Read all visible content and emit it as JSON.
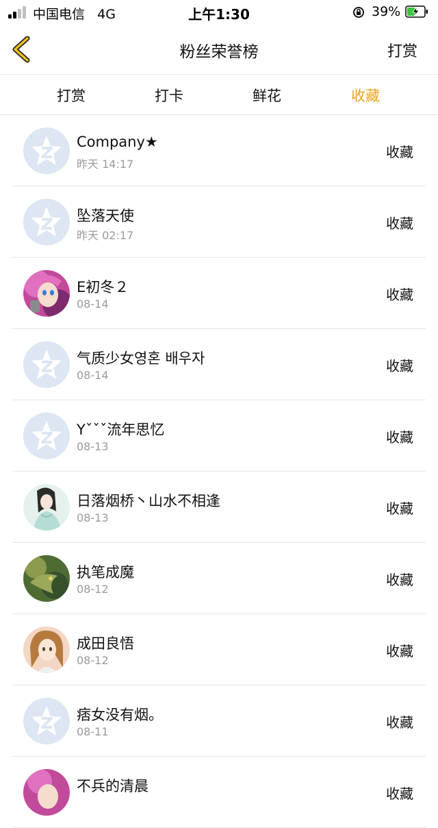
{
  "status_bar": {
    "carrier": "中国电信   4G",
    "time": "上午1:30",
    "battery": "39%"
  },
  "header": {
    "title": "粉丝荣誉榜",
    "action": "打赏",
    "back_icon": "chevron-left-icon"
  },
  "tabs": [
    {
      "label": "打赏",
      "active": false
    },
    {
      "label": "打卡",
      "active": false
    },
    {
      "label": "鲜花",
      "active": false
    },
    {
      "label": "收藏",
      "active": true
    }
  ],
  "colors": {
    "accent": "#f0a31c",
    "default_avatar_bg": "#dde6f2"
  },
  "fans": [
    {
      "name": "Company★",
      "time": "昨天 14:17",
      "action": "收藏",
      "avatar": "default-avatar-icon"
    },
    {
      "name": "坠落天使",
      "time": "昨天 02:17",
      "action": "收藏",
      "avatar": "default-avatar-icon"
    },
    {
      "name": "E初冬２",
      "time": "08-14",
      "action": "收藏",
      "avatar": "anime-pink-hair-avatar"
    },
    {
      "name": "气质少女영혼 배우자",
      "time": "08-14",
      "action": "收藏",
      "avatar": "default-avatar-icon"
    },
    {
      "name": "Yˇˇˇ流年思忆",
      "time": "08-13",
      "action": "收藏",
      "avatar": "default-avatar-icon"
    },
    {
      "name": "日落烟桥丶山水不相逢",
      "time": "08-13",
      "action": "收藏",
      "avatar": "ancient-costume-girl-avatar"
    },
    {
      "name": "执笔成魔",
      "time": "08-12",
      "action": "收藏",
      "avatar": "green-dragon-avatar"
    },
    {
      "name": "成田良悟",
      "time": "08-12",
      "action": "收藏",
      "avatar": "brown-hair-girl-avatar"
    },
    {
      "name": "痞女没有烟。",
      "time": "08-11",
      "action": "收藏",
      "avatar": "default-avatar-icon"
    },
    {
      "name": "不兵的清晨",
      "time": "",
      "action": "收藏",
      "avatar": "anime-pink-hair-avatar"
    }
  ]
}
